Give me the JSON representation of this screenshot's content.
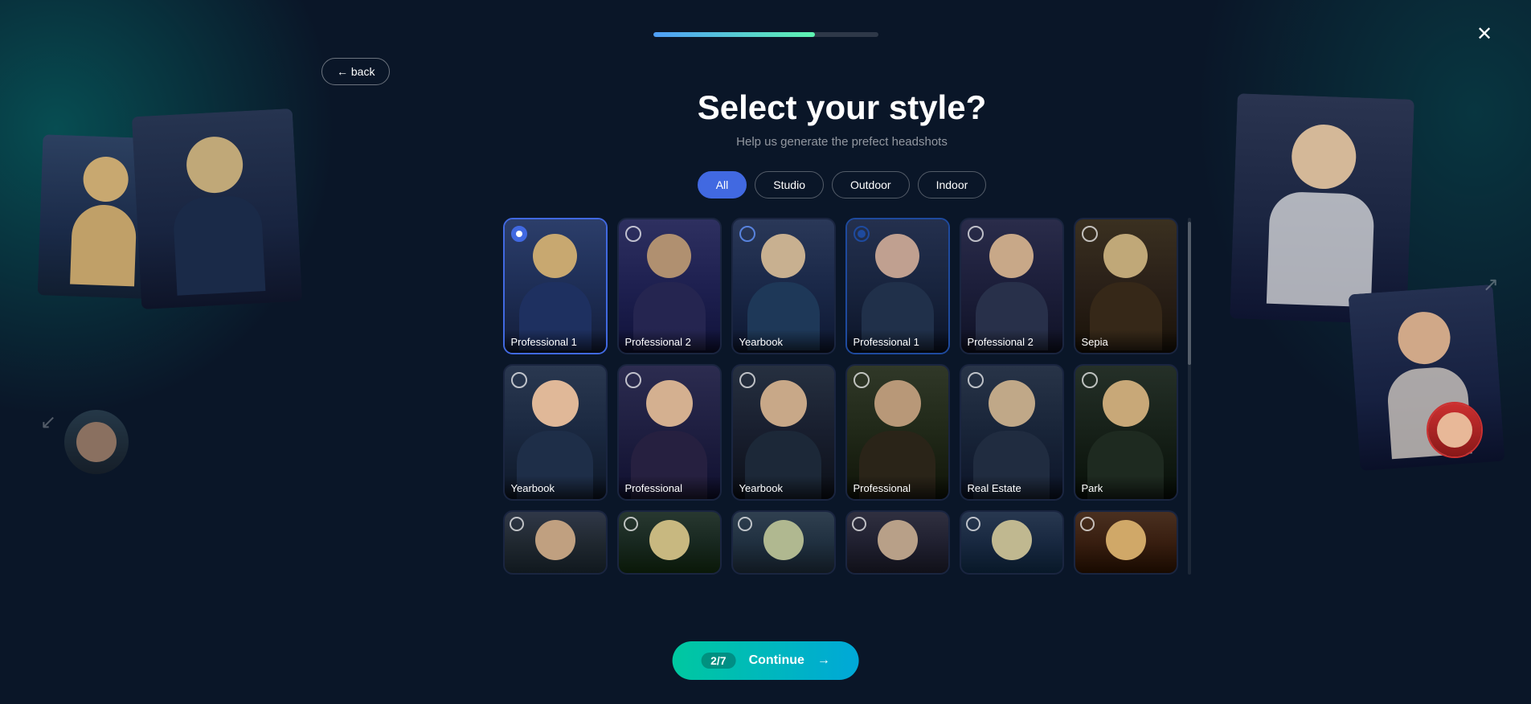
{
  "progress": {
    "fill_percent": "72%"
  },
  "close_button": {
    "label": "✕"
  },
  "back_button": {
    "label": "← back"
  },
  "page": {
    "title": "Select your style?",
    "subtitle": "Help us generate the prefect headshots"
  },
  "filters": {
    "tabs": [
      {
        "id": "all",
        "label": "All",
        "active": true
      },
      {
        "id": "studio",
        "label": "Studio",
        "active": false
      },
      {
        "id": "outdoor",
        "label": "Outdoor",
        "active": false
      },
      {
        "id": "indoor",
        "label": "Indoor",
        "active": false
      }
    ]
  },
  "style_cards": [
    {
      "id": "professional-1",
      "label": "Professional 1",
      "selected": "blue",
      "row": 1,
      "bg_class": "headshot-bg-1",
      "skin": "#c8a87a",
      "hair": "#3a2a1a"
    },
    {
      "id": "professional-2",
      "label": "Professional 2",
      "selected": "none",
      "row": 1,
      "bg_class": "headshot-bg-2",
      "skin": "#b09070",
      "hair": "#2a1a0a"
    },
    {
      "id": "yearbook",
      "label": "Yearbook",
      "selected": "empty",
      "row": 1,
      "bg_class": "headshot-bg-3",
      "skin": "#c8b090",
      "hair": "#4a3a2a"
    },
    {
      "id": "professional-1-f",
      "label": "Professional 1",
      "selected": "dark",
      "row": 1,
      "bg_class": "headshot-bg-4",
      "skin": "#c0a090",
      "hair": "#3a2a20"
    },
    {
      "id": "professional-2-f",
      "label": "Professional 2",
      "selected": "none",
      "row": 1,
      "bg_class": "headshot-bg-5",
      "skin": "#c8a888",
      "hair": "#4a3020"
    },
    {
      "id": "sepia",
      "label": "Sepia",
      "selected": "none",
      "row": 1,
      "bg_class": "headshot-bg-6",
      "skin": "#c0a878",
      "hair": "#5a4030"
    },
    {
      "id": "yearbook-2",
      "label": "Yearbook",
      "selected": "none",
      "row": 2,
      "bg_class": "headshot-bg-1",
      "skin": "#e0b898",
      "hair": "#5a4030"
    },
    {
      "id": "professional-3",
      "label": "Professional",
      "selected": "none",
      "row": 2,
      "bg_class": "headshot-bg-2",
      "skin": "#d4b090",
      "hair": "#4a3828"
    },
    {
      "id": "yearbook-3",
      "label": "Yearbook",
      "selected": "none",
      "row": 2,
      "bg_class": "headshot-bg-3",
      "skin": "#c8a888",
      "hair": "#3a2818"
    },
    {
      "id": "professional-4",
      "label": "Professional",
      "selected": "none",
      "row": 2,
      "bg_class": "headshot-bg-4",
      "skin": "#b89878",
      "hair": "#504040"
    },
    {
      "id": "real-estate",
      "label": "Real Estate",
      "selected": "none",
      "row": 2,
      "bg_class": "headshot-bg-5",
      "skin": "#c0a888",
      "hair": "#484038"
    },
    {
      "id": "park",
      "label": "Park",
      "selected": "none",
      "row": 2,
      "bg_class": "headshot-bg-6",
      "skin": "#c8a878",
      "hair": "#3a2c1e"
    },
    {
      "id": "style-r3-1",
      "label": "",
      "selected": "none",
      "row": 3,
      "bg_class": "headshot-bg-1"
    },
    {
      "id": "style-r3-2",
      "label": "",
      "selected": "none",
      "row": 3,
      "bg_class": "headshot-bg-2"
    },
    {
      "id": "style-r3-3",
      "label": "",
      "selected": "none",
      "row": 3,
      "bg_class": "headshot-bg-3"
    },
    {
      "id": "style-r3-4",
      "label": "",
      "selected": "none",
      "row": 3,
      "bg_class": "headshot-bg-4"
    },
    {
      "id": "style-r3-5",
      "label": "",
      "selected": "none",
      "row": 3,
      "bg_class": "headshot-bg-5"
    },
    {
      "id": "style-r3-6",
      "label": "",
      "selected": "none",
      "row": 3,
      "bg_class": "headshot-bg-6"
    }
  ],
  "continue_button": {
    "count": "2/7",
    "label": "Continue",
    "arrow": "→"
  }
}
